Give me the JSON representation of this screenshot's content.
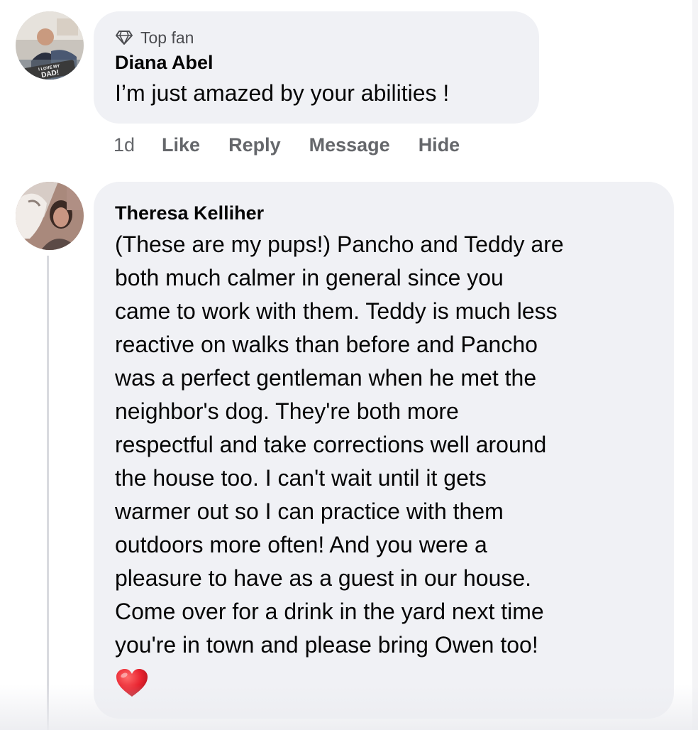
{
  "comments": [
    {
      "avatar_icon": "avatar-photo-man-i-love-my-dad",
      "avatar_caption": "I LOVE MY DAD!",
      "badge_icon": "diamond-icon",
      "badge": "Top fan",
      "author": "Diana Abel",
      "text": "I’m just amazed by your abilities !",
      "time": "1d",
      "actions": [
        "Like",
        "Reply",
        "Message",
        "Hide"
      ]
    },
    {
      "avatar_icon": "avatar-photo-woman-with-dog",
      "author": "Theresa Kelliher",
      "text": "(These are my pups!) Pancho and Teddy are\nboth much calmer in general since you\ncame to work with them. Teddy is much less\nreactive on walks than before and Pancho\nwas a perfect gentleman when he met the\nneighbor's dog.  They're both more\nrespectful and take corrections well around\nthe house too. I can't wait until it gets\nwarmer out so I can practice with them\noutdoors more often! And you were a\npleasure to have as a guest in our house.\nCome over for a drink in the yard next time\nyou're in town and please bring Owen too!",
      "emoji_icon": "red-heart-icon"
    }
  ],
  "colors": {
    "bubble": "#f0f1f5",
    "text": "#050505",
    "meta": "#65676b",
    "heart": "#e8232f"
  }
}
